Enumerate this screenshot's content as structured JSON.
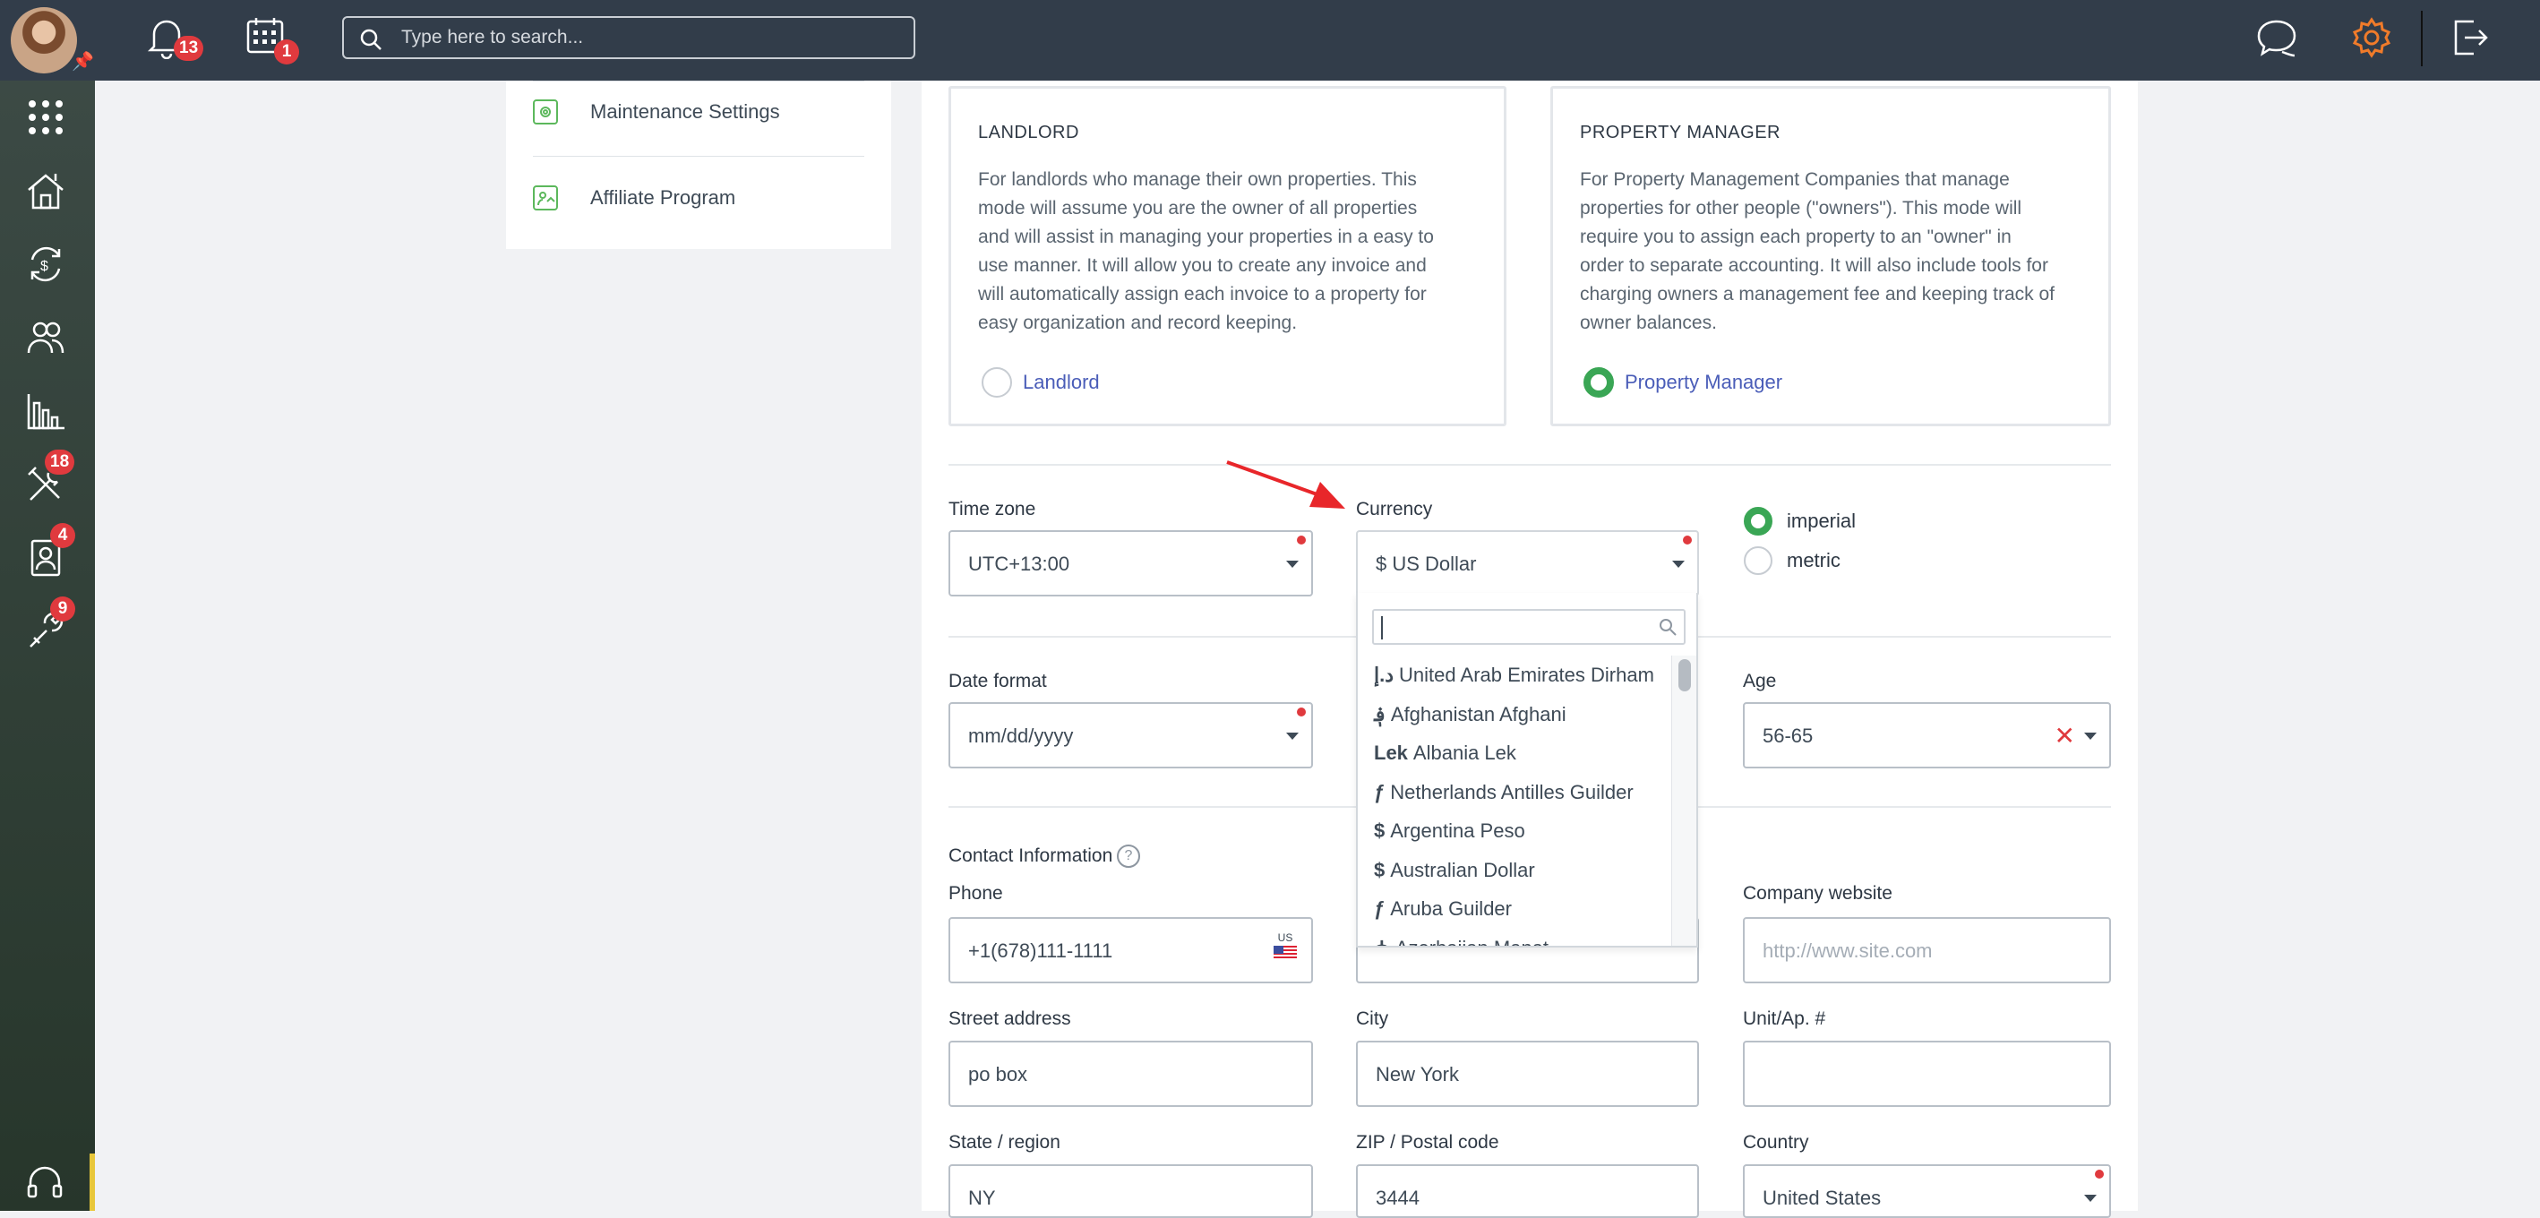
{
  "topbar": {
    "notifications_count": "13",
    "calendar_count": "1",
    "search_placeholder": "Type here to search..."
  },
  "sidebar": {
    "badges": {
      "maintenance": "18",
      "applicants": "4",
      "tools": "9"
    }
  },
  "settings_menu": {
    "items": [
      {
        "label": "Maintenance Settings"
      },
      {
        "label": "Affiliate Program"
      }
    ]
  },
  "modes": {
    "landlord": {
      "title": "LANDLORD",
      "desc_lines": [
        "For landlords who manage their own properties. This",
        "mode will assume you are the owner of all properties",
        "and will assist in managing your properties in a easy to",
        "use manner. It will allow you to create any invoice and",
        "will automatically assign each invoice to a property for",
        "easy organization and record keeping."
      ],
      "radio_label": "Landlord",
      "selected": false
    },
    "manager": {
      "title": "PROPERTY MANAGER",
      "desc_lines": [
        "For Property Management Companies that manage",
        "properties for other people (\"owners\"). This mode will",
        "require you to assign each property to an \"owner\" in",
        "order to separate accounting. It will also include tools for",
        "charging owners a management fee and keeping track of",
        "owner balances."
      ],
      "radio_label": "Property Manager",
      "selected": true
    }
  },
  "settings": {
    "timezone": {
      "label": "Time zone",
      "value": "UTC+13:00"
    },
    "currency": {
      "label": "Currency",
      "value": "$ US Dollar"
    },
    "units": {
      "imperial": "imperial",
      "metric": "metric",
      "selected": "imperial"
    },
    "date_format": {
      "label": "Date format",
      "value": "mm/dd/yyyy"
    },
    "age": {
      "label": "Age",
      "value": "56-65"
    }
  },
  "currency_dropdown": {
    "options": [
      {
        "symbol": "د.إ",
        "name": "United Arab Emirates Dirham"
      },
      {
        "symbol": "؋",
        "name": "Afghanistan Afghani"
      },
      {
        "symbol": "Lek",
        "name": "Albania Lek"
      },
      {
        "symbol": "ƒ",
        "name": "Netherlands Antilles Guilder"
      },
      {
        "symbol": "$",
        "name": "Argentina Peso"
      },
      {
        "symbol": "$",
        "name": "Australian Dollar"
      },
      {
        "symbol": "ƒ",
        "name": "Aruba Guilder"
      },
      {
        "symbol": "₼",
        "name": "Azerbaijan Manat"
      }
    ]
  },
  "contact": {
    "section_label": "Contact Information",
    "help": "?",
    "phone": {
      "label": "Phone",
      "value": "+1(678)111-1111",
      "country": "US"
    },
    "website": {
      "label": "Company website",
      "placeholder": "http://www.site.com"
    },
    "street": {
      "label": "Street address",
      "value": "po box"
    },
    "city": {
      "label": "City",
      "value": "New York"
    },
    "unit": {
      "label": "Unit/Ap. #",
      "value": ""
    },
    "state": {
      "label": "State / region",
      "value": "NY"
    },
    "zip": {
      "label": "ZIP / Postal code",
      "value": "3444"
    },
    "country": {
      "label": "Country",
      "value": "United States"
    }
  }
}
